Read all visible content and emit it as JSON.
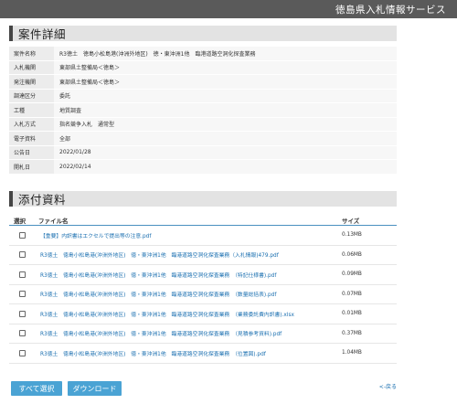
{
  "header": {
    "title": "徳島県入札情報サービス"
  },
  "detail_section": {
    "title": "案件詳細"
  },
  "details": [
    {
      "label": "案件名称",
      "value": "R3徳土　徳島小松島港(沖洲外地区)　徳・東沖洲1他　臨港道路空洞化探査業務"
    },
    {
      "label": "入札機関",
      "value": "東部県土整備局＜徳島＞"
    },
    {
      "label": "発注機関",
      "value": "東部県土整備局＜徳島＞"
    },
    {
      "label": "調達区分",
      "value": "委託"
    },
    {
      "label": "工種",
      "value": "地質調査"
    },
    {
      "label": "入札方式",
      "value": "指名競争入札　通常型"
    },
    {
      "label": "電子資料",
      "value": "全部"
    },
    {
      "label": "公告日",
      "value": "2022/01/28"
    },
    {
      "label": "開札日",
      "value": "2022/02/14"
    }
  ],
  "attachments_section": {
    "title": "添付資料"
  },
  "files_table": {
    "headers": {
      "select": "選択",
      "name": "ファイル名",
      "size": "サイズ"
    },
    "rows": [
      {
        "name": "【重要】内訳書はエクセルで提出等の注意.pdf",
        "size": "0.13MB"
      },
      {
        "name": "R3徳土　徳島小松島港(沖洲外地区)　徳・東沖洲1他　臨港道路空洞化探査業務（入札情報)479.pdf",
        "size": "0.06MB"
      },
      {
        "name": "R3徳土　徳島小松島港(沖洲外地区)　徳・東沖洲1他　臨港道路空洞化探査業務　（特記仕様書).pdf",
        "size": "0.09MB"
      },
      {
        "name": "R3徳土　徳島小松島港(沖洲外地区)　徳・東沖洲1他　臨港道路空洞化探査業務　（数量総括表).pdf",
        "size": "0.07MB"
      },
      {
        "name": "R3徳土　徳島小松島港(沖洲外地区)　徳・東沖洲1他　臨港道路空洞化探査業務　（業務委託費内訳書).xlsx",
        "size": "0.01MB"
      },
      {
        "name": "R3徳土　徳島小松島港(沖洲外地区)　徳・東沖洲1他　臨港道路空洞化探査業務　（見積参考資料).pdf",
        "size": "0.37MB"
      },
      {
        "name": "R3徳土　徳島小松島港(沖洲外地区)　徳・東沖洲1他　臨港道路空洞化探査業務　（位置図).pdf",
        "size": "1.04MB"
      }
    ]
  },
  "actions": {
    "select_all": "すべて選択",
    "download": "ダウンロード",
    "back": "<-戻る"
  }
}
